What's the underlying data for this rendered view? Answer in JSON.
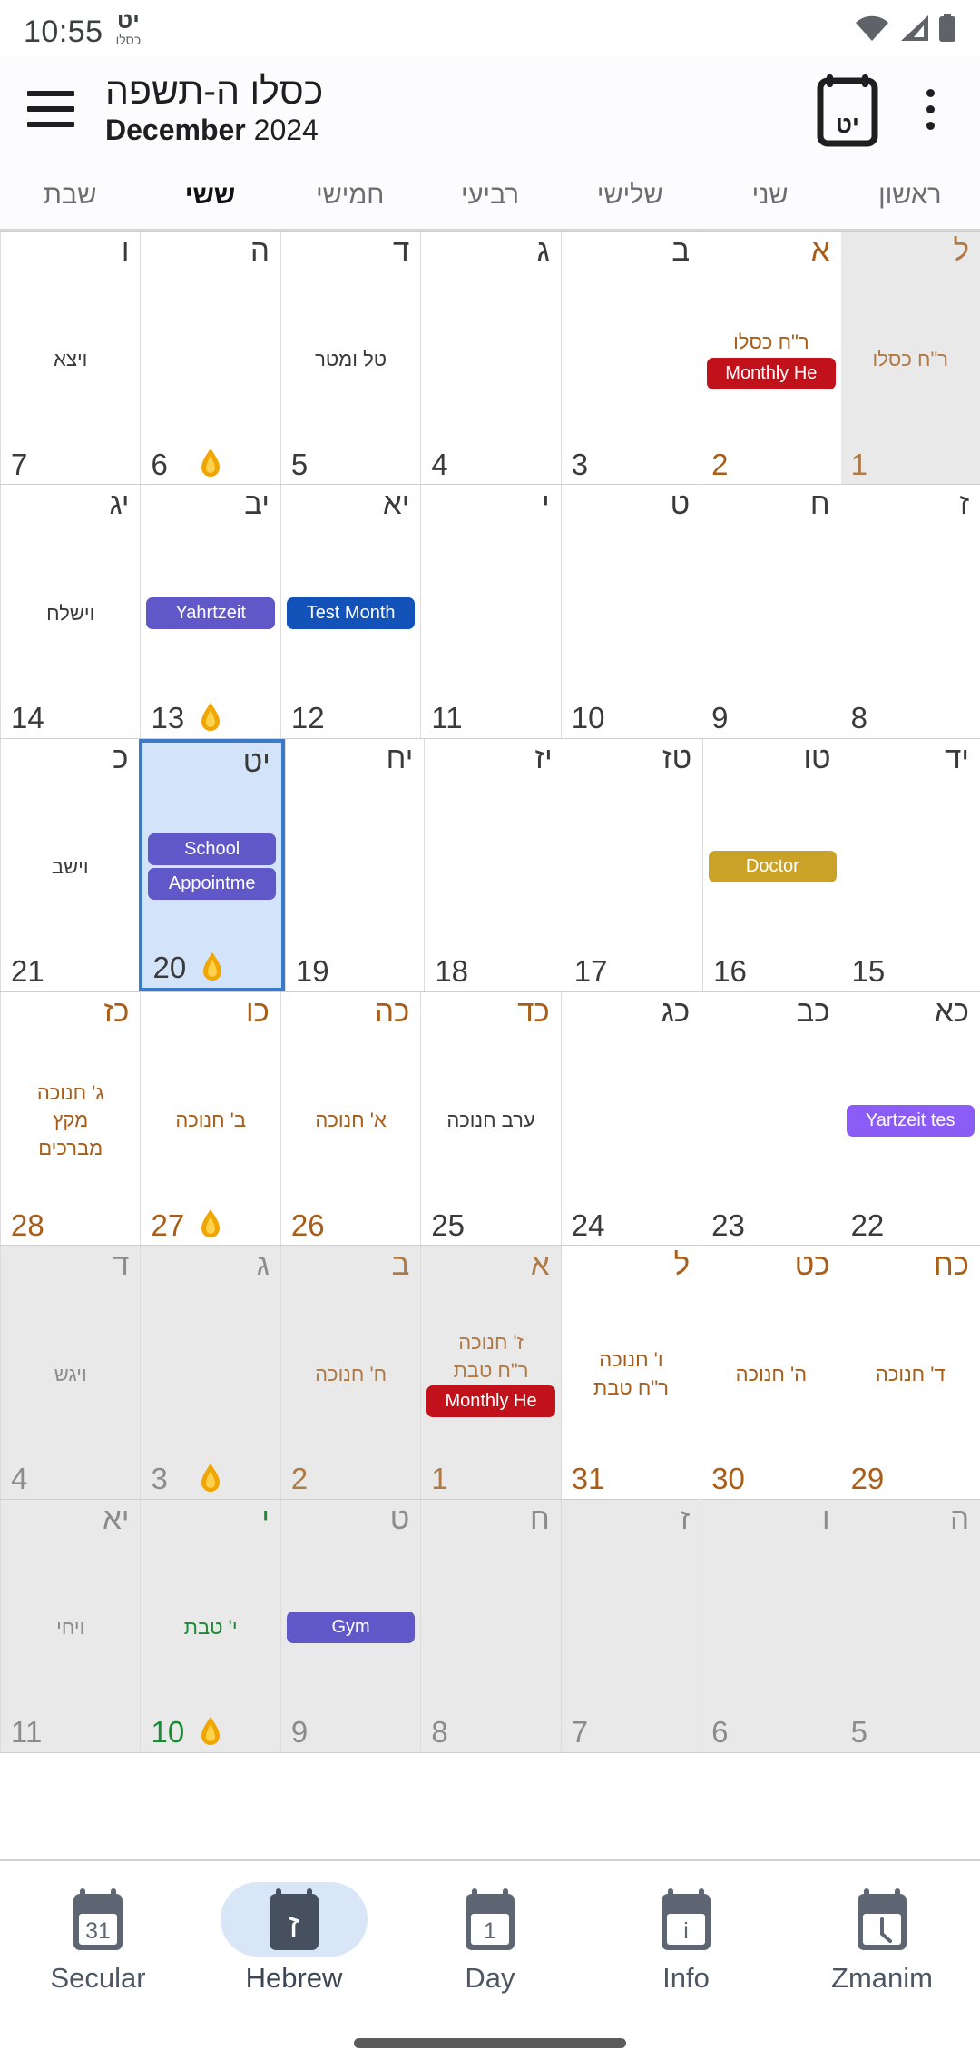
{
  "status_bar": {
    "time": "10:55",
    "hebrew_day": "יט",
    "hebrew_month": "כסלו",
    "icons": [
      "wifi-icon",
      "cellular-signal-icon",
      "battery-icon"
    ]
  },
  "toolbar": {
    "menu_icon": "hamburger-menu-icon",
    "title_hebrew": "כסלו ה-תשפה",
    "title_month": "December",
    "title_year": "2024",
    "today_button_label": "יט",
    "today_icon": "calendar-today-icon",
    "overflow_icon": "more-vertical-icon"
  },
  "weekdays": [
    "ראשון",
    "שני",
    "שלישי",
    "רביעי",
    "חמישי",
    "ששי",
    "שבת"
  ],
  "weekday_today_index": 5,
  "colors": {
    "holiday": "#a85e18",
    "fast": "#1a8a34",
    "selected_bg": "#d3e3fa",
    "selected_border": "#3b7ac9",
    "outside_bg": "#e9e9e9",
    "chip_purple": "#6058c8",
    "chip_blue": "#1352b8",
    "chip_gold": "#c9a227",
    "chip_red": "#c1121c",
    "chip_violet": "#8b5cf6",
    "nav_active_pill": "#d8e6f8"
  },
  "weeks": [
    {
      "days": [
        {
          "heb": "ל",
          "sec": "1",
          "outside": true,
          "heb_style": "dimrh",
          "sec_style": "dimrh",
          "texts": [
            {
              "t": "ר\"ח כסלו",
              "style": "dimholi"
            }
          ],
          "chips": [],
          "candle": false
        },
        {
          "heb": "א",
          "sec": "2",
          "heb_style": "rh",
          "sec_style": "rh",
          "texts": [
            {
              "t": "ר\"ח כסלו",
              "style": "holi"
            }
          ],
          "chips": [
            {
              "label": "Monthly He",
              "color": "chip_red"
            }
          ],
          "candle": false
        },
        {
          "heb": "ב",
          "sec": "3",
          "texts": [],
          "chips": [],
          "candle": false
        },
        {
          "heb": "ג",
          "sec": "4",
          "texts": [],
          "chips": [],
          "candle": false
        },
        {
          "heb": "ד",
          "sec": "5",
          "texts": [
            {
              "t": "טל ומטר",
              "style": ""
            }
          ],
          "chips": [],
          "candle": false
        },
        {
          "heb": "ה",
          "sec": "6",
          "texts": [],
          "chips": [],
          "candle": true
        },
        {
          "heb": "ו",
          "sec": "7",
          "texts": [
            {
              "t": "ויצא",
              "style": ""
            }
          ],
          "chips": [],
          "candle": false
        }
      ]
    },
    {
      "days": [
        {
          "heb": "ז",
          "sec": "8",
          "texts": [],
          "chips": [],
          "candle": false
        },
        {
          "heb": "ח",
          "sec": "9",
          "texts": [],
          "chips": [],
          "candle": false
        },
        {
          "heb": "ט",
          "sec": "10",
          "texts": [],
          "chips": [],
          "candle": false
        },
        {
          "heb": "י",
          "sec": "11",
          "texts": [],
          "chips": [],
          "candle": false
        },
        {
          "heb": "יא",
          "sec": "12",
          "texts": [],
          "chips": [
            {
              "label": "Test Month",
              "color": "chip_blue"
            }
          ],
          "candle": false
        },
        {
          "heb": "יב",
          "sec": "13",
          "texts": [],
          "chips": [
            {
              "label": "Yahrtzeit",
              "color": "chip_purple"
            }
          ],
          "candle": true
        },
        {
          "heb": "יג",
          "sec": "14",
          "texts": [
            {
              "t": "וישלח",
              "style": ""
            }
          ],
          "chips": [],
          "candle": false
        }
      ]
    },
    {
      "days": [
        {
          "heb": "יד",
          "sec": "15",
          "texts": [],
          "chips": [],
          "candle": false
        },
        {
          "heb": "טו",
          "sec": "16",
          "texts": [],
          "chips": [
            {
              "label": "Doctor",
              "color": "chip_gold"
            }
          ],
          "candle": false
        },
        {
          "heb": "טז",
          "sec": "17",
          "texts": [],
          "chips": [],
          "candle": false
        },
        {
          "heb": "יז",
          "sec": "18",
          "texts": [],
          "chips": [],
          "candle": false
        },
        {
          "heb": "יח",
          "sec": "19",
          "texts": [],
          "chips": [],
          "candle": false
        },
        {
          "heb": "יט",
          "sec": "20",
          "selected": true,
          "texts": [],
          "chips": [
            {
              "label": "School",
              "color": "chip_purple"
            },
            {
              "label": "Appointme",
              "color": "chip_purple"
            }
          ],
          "candle": true
        },
        {
          "heb": "כ",
          "sec": "21",
          "texts": [
            {
              "t": "וישב",
              "style": ""
            }
          ],
          "chips": [],
          "candle": false
        }
      ]
    },
    {
      "days": [
        {
          "heb": "כא",
          "sec": "22",
          "texts": [],
          "chips": [
            {
              "label": "Yartzeit tes",
              "color": "chip_violet"
            }
          ],
          "candle": false
        },
        {
          "heb": "כב",
          "sec": "23",
          "texts": [],
          "chips": [],
          "candle": false
        },
        {
          "heb": "כג",
          "sec": "24",
          "texts": [],
          "chips": [],
          "candle": false
        },
        {
          "heb": "כד",
          "sec": "25",
          "heb_style": "rh",
          "texts": [
            {
              "t": "ערב חנוכה",
              "style": ""
            }
          ],
          "chips": [],
          "candle": false
        },
        {
          "heb": "כה",
          "sec": "26",
          "heb_style": "rh",
          "sec_style": "rh",
          "texts": [
            {
              "t": "א' חנוכה",
              "style": "holi"
            }
          ],
          "chips": [],
          "candle": false
        },
        {
          "heb": "כו",
          "sec": "27",
          "heb_style": "rh",
          "sec_style": "rh",
          "texts": [
            {
              "t": "ב' חנוכה",
              "style": "holi"
            }
          ],
          "chips": [],
          "candle": true
        },
        {
          "heb": "כז",
          "sec": "28",
          "heb_style": "rh",
          "sec_style": "rh",
          "texts": [
            {
              "t": "ג' חנוכה",
              "style": "holi"
            },
            {
              "t": "מקץ",
              "style": "holi"
            },
            {
              "t": "מברכים",
              "style": "holi"
            }
          ],
          "chips": [],
          "candle": false
        }
      ]
    },
    {
      "days": [
        {
          "heb": "כח",
          "sec": "29",
          "heb_style": "rh",
          "sec_style": "rh",
          "texts": [
            {
              "t": "ד' חנוכה",
              "style": "holi"
            }
          ],
          "chips": [],
          "candle": false
        },
        {
          "heb": "כט",
          "sec": "30",
          "heb_style": "rh",
          "sec_style": "rh",
          "texts": [
            {
              "t": "ה' חנוכה",
              "style": "holi"
            }
          ],
          "chips": [],
          "candle": false
        },
        {
          "heb": "ל",
          "sec": "31",
          "heb_style": "rh",
          "sec_style": "rh",
          "texts": [
            {
              "t": "ו' חנוכה",
              "style": "holi"
            },
            {
              "t": "ר\"ח טבת",
              "style": "holi"
            }
          ],
          "chips": [],
          "candle": false
        },
        {
          "heb": "א",
          "sec": "1",
          "outside": true,
          "heb_style": "dimrh",
          "sec_style": "dimrh",
          "texts": [
            {
              "t": "ז' חנוכה",
              "style": "dimholi"
            },
            {
              "t": "ר\"ח טבת",
              "style": "dimholi"
            }
          ],
          "chips": [
            {
              "label": "Monthly He",
              "color": "chip_red"
            }
          ],
          "candle": false
        },
        {
          "heb": "ב",
          "sec": "2",
          "outside": true,
          "heb_style": "dimrh",
          "sec_style": "dimrh",
          "texts": [
            {
              "t": "ח' חנוכה",
              "style": "dimholi"
            }
          ],
          "chips": [],
          "candle": false
        },
        {
          "heb": "ג",
          "sec": "3",
          "outside": true,
          "heb_style": "dim",
          "sec_style": "dim",
          "texts": [],
          "chips": [],
          "candle": true
        },
        {
          "heb": "ד",
          "sec": "4",
          "outside": true,
          "heb_style": "dim",
          "sec_style": "dim",
          "texts": [
            {
              "t": "ויגש",
              "style": "dim"
            }
          ],
          "chips": [],
          "candle": false
        }
      ]
    },
    {
      "days": [
        {
          "heb": "ה",
          "sec": "5",
          "outside": true,
          "heb_style": "dim",
          "sec_style": "dim",
          "texts": [],
          "chips": [],
          "candle": false
        },
        {
          "heb": "ו",
          "sec": "6",
          "outside": true,
          "heb_style": "dim",
          "sec_style": "dim",
          "texts": [],
          "chips": [],
          "candle": false
        },
        {
          "heb": "ז",
          "sec": "7",
          "outside": true,
          "heb_style": "dim",
          "sec_style": "dim",
          "texts": [],
          "chips": [],
          "candle": false
        },
        {
          "heb": "ח",
          "sec": "8",
          "outside": true,
          "heb_style": "dim",
          "sec_style": "dim",
          "texts": [],
          "chips": [],
          "candle": false
        },
        {
          "heb": "ט",
          "sec": "9",
          "outside": true,
          "heb_style": "dim",
          "sec_style": "dim",
          "texts": [],
          "chips": [
            {
              "label": "Gym",
              "color": "chip_purple"
            }
          ],
          "candle": false
        },
        {
          "heb": "י",
          "sec": "10",
          "outside": true,
          "heb_style": "fast",
          "sec_style": "fast",
          "texts": [
            {
              "t": "י' טבת",
              "style": "fastc"
            }
          ],
          "chips": [],
          "candle": true
        },
        {
          "heb": "יא",
          "sec": "11",
          "outside": true,
          "heb_style": "dim",
          "sec_style": "dim",
          "texts": [
            {
              "t": "ויחי",
              "style": "dim"
            }
          ],
          "chips": [],
          "candle": false
        }
      ]
    }
  ],
  "bottom_nav": {
    "items": [
      {
        "label": "Secular",
        "icon": "calendar-31-icon",
        "active": false
      },
      {
        "label": "Hebrew",
        "icon": "calendar-hebrew-icon",
        "active": true
      },
      {
        "label": "Day",
        "icon": "calendar-1-icon",
        "active": false
      },
      {
        "label": "Info",
        "icon": "calendar-info-icon",
        "active": false
      },
      {
        "label": "Zmanim",
        "icon": "calendar-clock-icon",
        "active": false
      }
    ]
  }
}
